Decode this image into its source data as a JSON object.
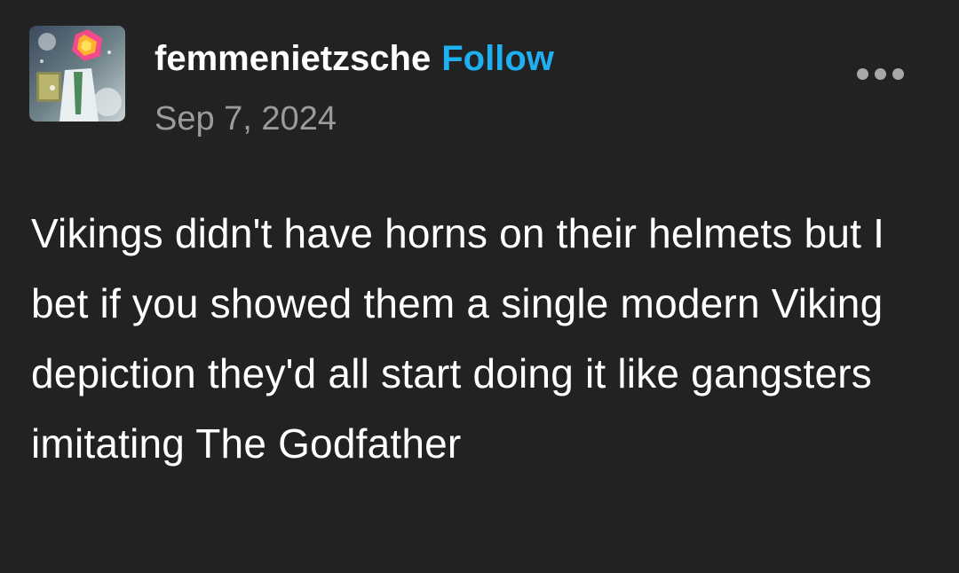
{
  "post": {
    "author": {
      "username": "femmenietzsche",
      "follow_label": "Follow",
      "avatar_icon": "avatar-illustration-icon"
    },
    "date": "Sep 7, 2024",
    "more_icon": "ellipsis-icon",
    "body": "Vikings didn't have horns on their helmets but I bet if you showed them a single modern Viking depiction they'd all start doing it like gangsters imitating The Godfather"
  },
  "colors": {
    "background": "#222222",
    "text": "#ffffff",
    "follow": "#1eb0f0",
    "muted": "#9b9b9b",
    "dots": "#a8a8a8"
  }
}
